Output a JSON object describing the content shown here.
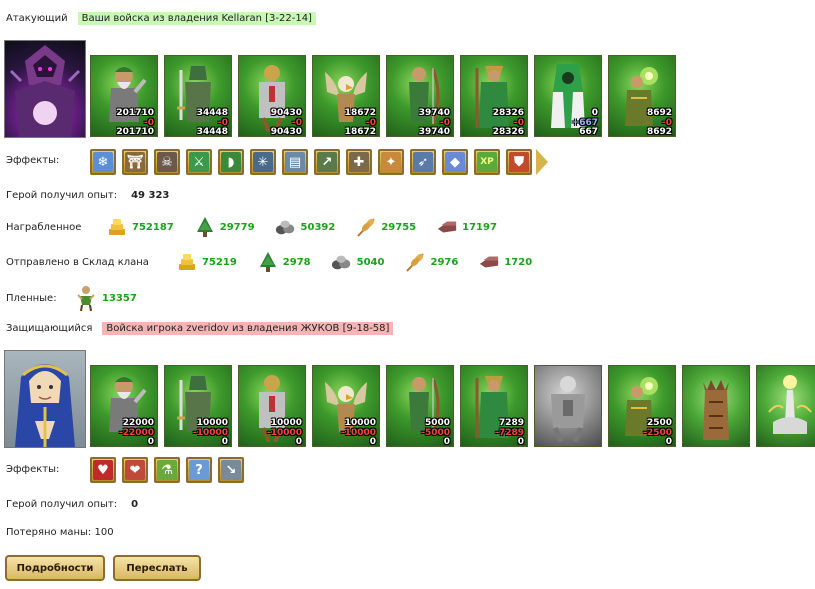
{
  "attacker": {
    "label": "Атакующий",
    "title": "Ваши войска из владения Kellaran [3-22-14]",
    "units": [
      {
        "name": "dwarf",
        "top": "201710",
        "mid": "-0",
        "bot": "201710"
      },
      {
        "name": "swordsman",
        "top": "34448",
        "mid": "-0",
        "bot": "34448"
      },
      {
        "name": "knight",
        "top": "90430",
        "mid": "-0",
        "bot": "90430"
      },
      {
        "name": "griffin",
        "top": "18672",
        "mid": "-0",
        "bot": "18672"
      },
      {
        "name": "archer",
        "top": "39740",
        "mid": "-0",
        "bot": "39740"
      },
      {
        "name": "druid",
        "top": "28326",
        "mid": "-0",
        "bot": "28326"
      },
      {
        "name": "green-mage",
        "top": "0",
        "mid": "+667",
        "bot": "667"
      },
      {
        "name": "shaman",
        "top": "8692",
        "mid": "-0",
        "bot": "8692"
      }
    ],
    "effects_label": "Эффекты:",
    "effects": [
      "ice",
      "gate",
      "skull",
      "sword",
      "bow",
      "web",
      "barrel",
      "spear",
      "shield-cross",
      "rune",
      "arrows",
      "gem",
      "xp",
      "shield"
    ],
    "xp_label": "Герой получил опыт:",
    "xp_value": "49 323",
    "loot_label": "Награбленное",
    "loot": [
      {
        "icon": "gold",
        "value": "752187"
      },
      {
        "icon": "wood",
        "value": "29779"
      },
      {
        "icon": "stone",
        "value": "50392"
      },
      {
        "icon": "wheat",
        "value": "29755"
      },
      {
        "icon": "iron",
        "value": "17197"
      }
    ],
    "sent_label": "Отправлено в Склад клана",
    "sent": [
      {
        "icon": "gold",
        "value": "75219"
      },
      {
        "icon": "wood",
        "value": "2978"
      },
      {
        "icon": "stone",
        "value": "5040"
      },
      {
        "icon": "wheat",
        "value": "2976"
      },
      {
        "icon": "iron",
        "value": "1720"
      }
    ],
    "prisoners_label": "Пленные:",
    "prisoners_value": "13357"
  },
  "defender": {
    "label": "Защищающийся",
    "title": "Войска игрока zveridov из владения ЖУКОВ [9-18-58]",
    "units": [
      {
        "name": "dwarf",
        "top": "22000",
        "mid": "-22000",
        "bot": "0"
      },
      {
        "name": "swordsman",
        "top": "10000",
        "mid": "-10000",
        "bot": "0"
      },
      {
        "name": "knight",
        "top": "10000",
        "mid": "-10000",
        "bot": "0"
      },
      {
        "name": "griffin",
        "top": "10000",
        "mid": "-10000",
        "bot": "0"
      },
      {
        "name": "archer",
        "top": "5000",
        "mid": "-5000",
        "bot": "0"
      },
      {
        "name": "druid",
        "top": "7289",
        "mid": "-7289",
        "bot": "0"
      },
      {
        "name": "stone-golem",
        "top": "",
        "mid": "",
        "bot": ""
      },
      {
        "name": "shaman",
        "top": "2500",
        "mid": "-2500",
        "bot": "0"
      },
      {
        "name": "tower",
        "top": "",
        "mid": "",
        "bot": ""
      },
      {
        "name": "altar",
        "top": "",
        "mid": "",
        "bot": ""
      }
    ],
    "effects_label": "Эффекты:",
    "effects": [
      "heart",
      "heart-hand",
      "potion",
      "question",
      "blade"
    ],
    "xp_label": "Герой получил опыт:",
    "xp_value": "0",
    "mana_label": "Потеряно маны: 100"
  },
  "buttons": {
    "details": "Подробности",
    "forward": "Переслать"
  },
  "colors": {
    "attacker_tag": "#c8f7b8",
    "defender_tag": "#f7b4b4",
    "resource_value": "#1aa31a",
    "loss": "#ff4040"
  }
}
